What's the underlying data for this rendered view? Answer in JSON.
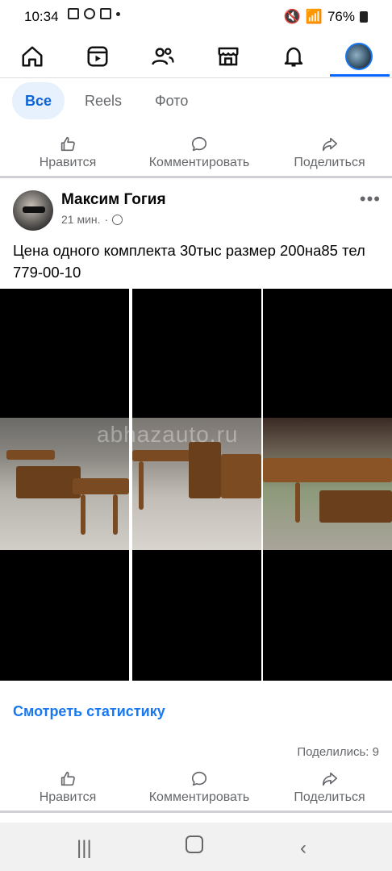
{
  "status": {
    "time": "10:34",
    "battery": "76%"
  },
  "filters": {
    "all": "Все",
    "reels": "Reels",
    "photo": "Фото"
  },
  "actions": {
    "like": "Нравится",
    "comment": "Комментировать",
    "share": "Поделиться"
  },
  "post": {
    "author": "Максим Гогия",
    "time": "21 мин.",
    "text": "Цена одного комплекта 30тыс размер 200на85 тел 779-00-10",
    "watermark": "abhazauto.ru",
    "stats_link": "Смотреть статистику",
    "shares": "Поделились: 9"
  },
  "icons": {
    "home": "home-icon",
    "reels": "reels-icon",
    "friends": "friends-icon",
    "marketplace": "marketplace-icon",
    "notifications": "bell-icon",
    "profile": "profile-avatar",
    "accent": "#1877f2"
  }
}
